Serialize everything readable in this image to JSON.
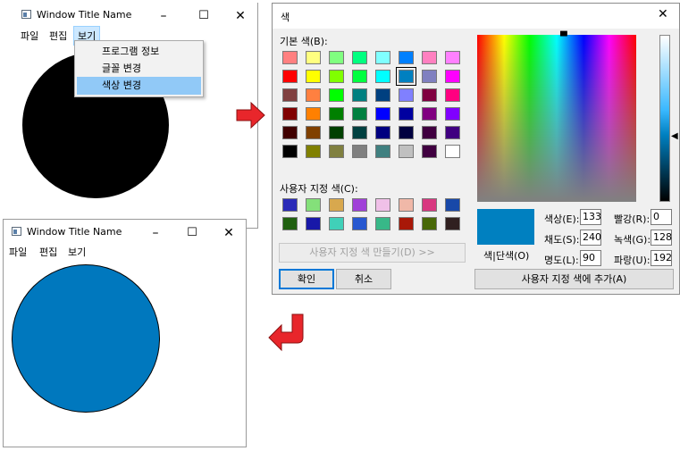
{
  "window_top": {
    "title": "Window Title Name",
    "menu": [
      "파일",
      "편집",
      "보기"
    ],
    "circle_color": "#000000",
    "context_menu": {
      "items": [
        "프로그램 정보",
        "글꼴 변경",
        "색상 변경"
      ],
      "selected_index": 2
    }
  },
  "window_bottom": {
    "title": "Window Title Name",
    "menu": [
      "파일",
      "편집",
      "보기"
    ],
    "circle_color": "#0078be"
  },
  "color_dialog": {
    "title": "색",
    "basic_colors_label": "기본 색(B):",
    "custom_colors_label": "사용자 지정 색(C):",
    "define_custom_button": "사용자 지정 색 만들기(D) >>",
    "ok_button": "확인",
    "cancel_button": "취소",
    "add_custom_button": "사용자 지정 색에 추가(A)",
    "solid_label": "색|단색(O)",
    "labels": {
      "hue": "색상(E):",
      "sat": "채도(S):",
      "lum": "명도(L):",
      "red": "빨강(R):",
      "green": "녹색(G):",
      "blue": "파랑(U):"
    },
    "values": {
      "hue": "133",
      "sat": "240",
      "lum": "90",
      "red": "0",
      "green": "128",
      "blue": "192"
    },
    "selected_color": "#0080c0",
    "basic_colors": [
      [
        "#ff8080",
        "#ffff80",
        "#80ff80",
        "#00ff80",
        "#80ffff",
        "#0080ff",
        "#ff80c0",
        "#ff80ff"
      ],
      [
        "#ff0000",
        "#ffff00",
        "#80ff00",
        "#00ff40",
        "#00ffff",
        "#0080c0",
        "#8080c0",
        "#ff00ff"
      ],
      [
        "#804040",
        "#ff8040",
        "#00ff00",
        "#008080",
        "#004080",
        "#8080ff",
        "#800040",
        "#ff0080"
      ],
      [
        "#800000",
        "#ff8000",
        "#008000",
        "#008040",
        "#0000ff",
        "#0000a0",
        "#800080",
        "#8000ff"
      ],
      [
        "#400000",
        "#804000",
        "#004000",
        "#004040",
        "#000080",
        "#000040",
        "#400040",
        "#400080"
      ],
      [
        "#000000",
        "#808000",
        "#808040",
        "#808080",
        "#408080",
        "#c0c0c0",
        "#400040",
        "#ffffff"
      ]
    ],
    "active_basic": [
      1,
      5
    ],
    "custom_colors": [
      [
        "#2a2ab8",
        "#84e07a",
        "#d8a84e",
        "#a040d8",
        "#f0c0e8",
        "#f0b8a8",
        "#d83880",
        "#1848a8"
      ],
      [
        "#206010",
        "#1818a8",
        "#40d0b8",
        "#2858d0",
        "#38b888",
        "#a81808",
        "#486808",
        "#302020"
      ]
    ]
  }
}
